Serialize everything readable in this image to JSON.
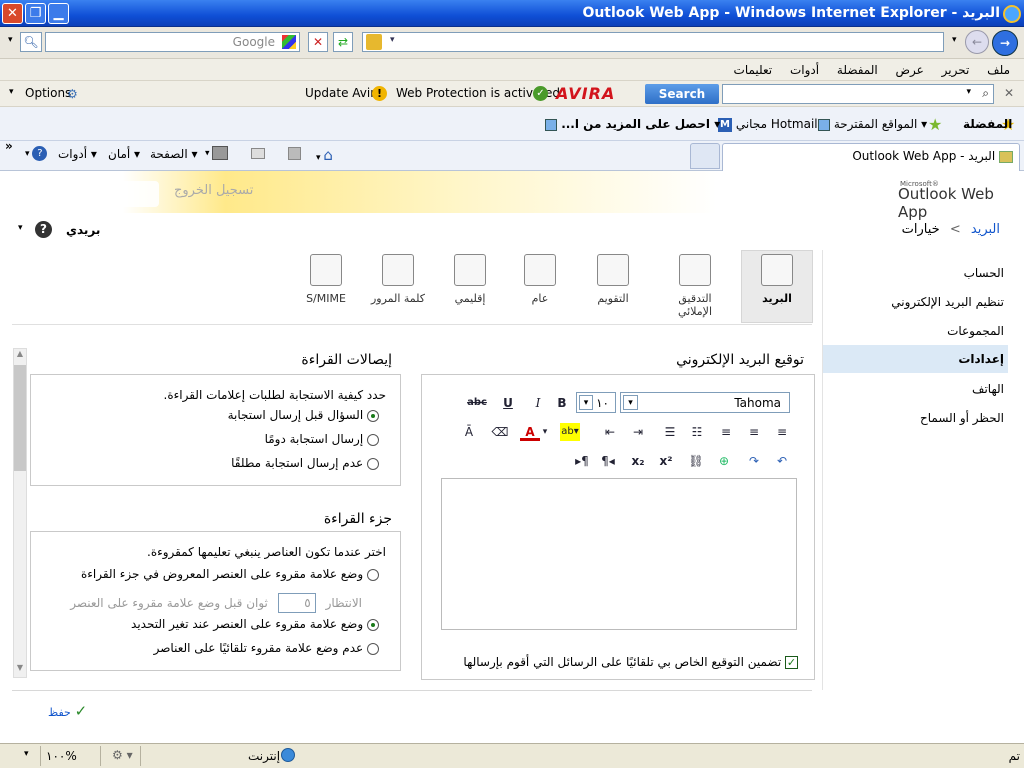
{
  "window": {
    "title": "البريد - Outlook Web App - Windows Internet Explorer"
  },
  "browser": {
    "search_engine": "Google",
    "menu": [
      "ملف",
      "تحرير",
      "عرض",
      "المفضلة",
      "أدوات",
      "تعليمات"
    ],
    "avira": {
      "search_button": "Search",
      "brand": "AVIRA",
      "web_protection": "Web Protection is activated",
      "update": "Update Avira",
      "options": "Options"
    },
    "favorites": {
      "label": "المفضلة",
      "suggested_sites": "المواقع المقترحة",
      "hotmail": "Hotmail مجاني",
      "get_more": "احصل على المزيد من ا..."
    },
    "tab_title": "البريد - Outlook Web App",
    "commands": [
      "الصفحة",
      "أمان",
      "أدوات"
    ]
  },
  "owa": {
    "logo_small": "Microsoft®",
    "logo": "Outlook Web App",
    "signout": "تسجيل الخروج",
    "breadcrumb": {
      "root": "البريد",
      "sep": ">",
      "current": "خيارات"
    },
    "my_mail": "بريدي",
    "help": "?",
    "nav": [
      "الحساب",
      "تنظيم البريد الإلكتروني",
      "المجموعات",
      "إعدادات",
      "الهاتف",
      "الحظر أو السماح"
    ],
    "nav_selected": "إعدادات",
    "tabs": [
      "البريد",
      "التدقيق الإملائي",
      "التقويم",
      "عام",
      "إقليمي",
      "كلمة المرور",
      "S/MIME"
    ],
    "signature": {
      "title": "توقيع البريد الإلكتروني",
      "font": "Tahoma",
      "size": "١٠",
      "include_label": "تضمين التوقيع الخاص بي تلقائيًا على الرسائل التي أقوم بإرسالها"
    },
    "receipts": {
      "title": "إيصالات القراءة",
      "prompt": "حدد كيفية الاستجابة لطلبات إعلامات القراءة.",
      "options": [
        "السؤال قبل إرسال استجابة",
        "إرسال استجابة دومًا",
        "عدم إرسال استجابة مطلقًا"
      ],
      "selected": 0
    },
    "reading_pane": {
      "title": "جزء القراءة",
      "prompt": "اختر عندما تكون العناصر ينبغي تعليمها كمقروءة.",
      "options": [
        "وضع علامة مقروء على العنصر المعروض في جزء القراءة",
        "وضع علامة مقروء على العنصر عند تغير التحديد",
        "عدم وضع علامة مقروء تلقائيًا على العناصر"
      ],
      "wait_label": "الانتظار",
      "wait_value": "٥",
      "wait_suffix": "ثوان قبل وضع علامة مقروء على العنصر",
      "selected": 1
    },
    "save": "حفظ"
  },
  "status": {
    "left": "تم",
    "zone": "إنترنت",
    "zoom": "١٠٠%"
  }
}
